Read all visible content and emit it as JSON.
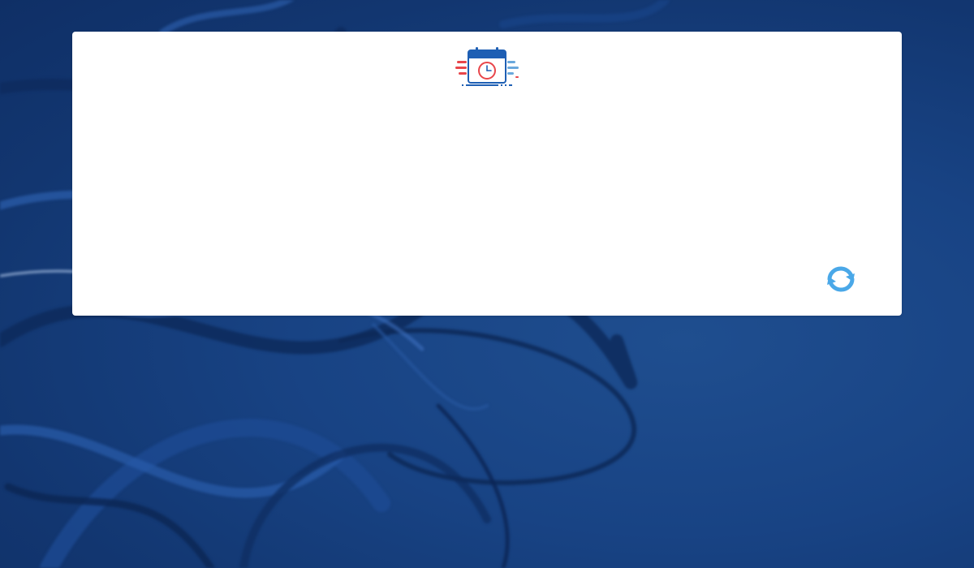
{
  "colors": {
    "background": "#184384",
    "panel": "#ffffff",
    "logo_primary": "#1e5fb4",
    "logo_accent_red": "#e8454a",
    "logo_accent_blue": "#6aa8dc",
    "refresh_icon": "#4aa8e8"
  },
  "panel": {
    "logo_icon": "calendar-clock-icon",
    "refresh_icon": "refresh-icon"
  }
}
